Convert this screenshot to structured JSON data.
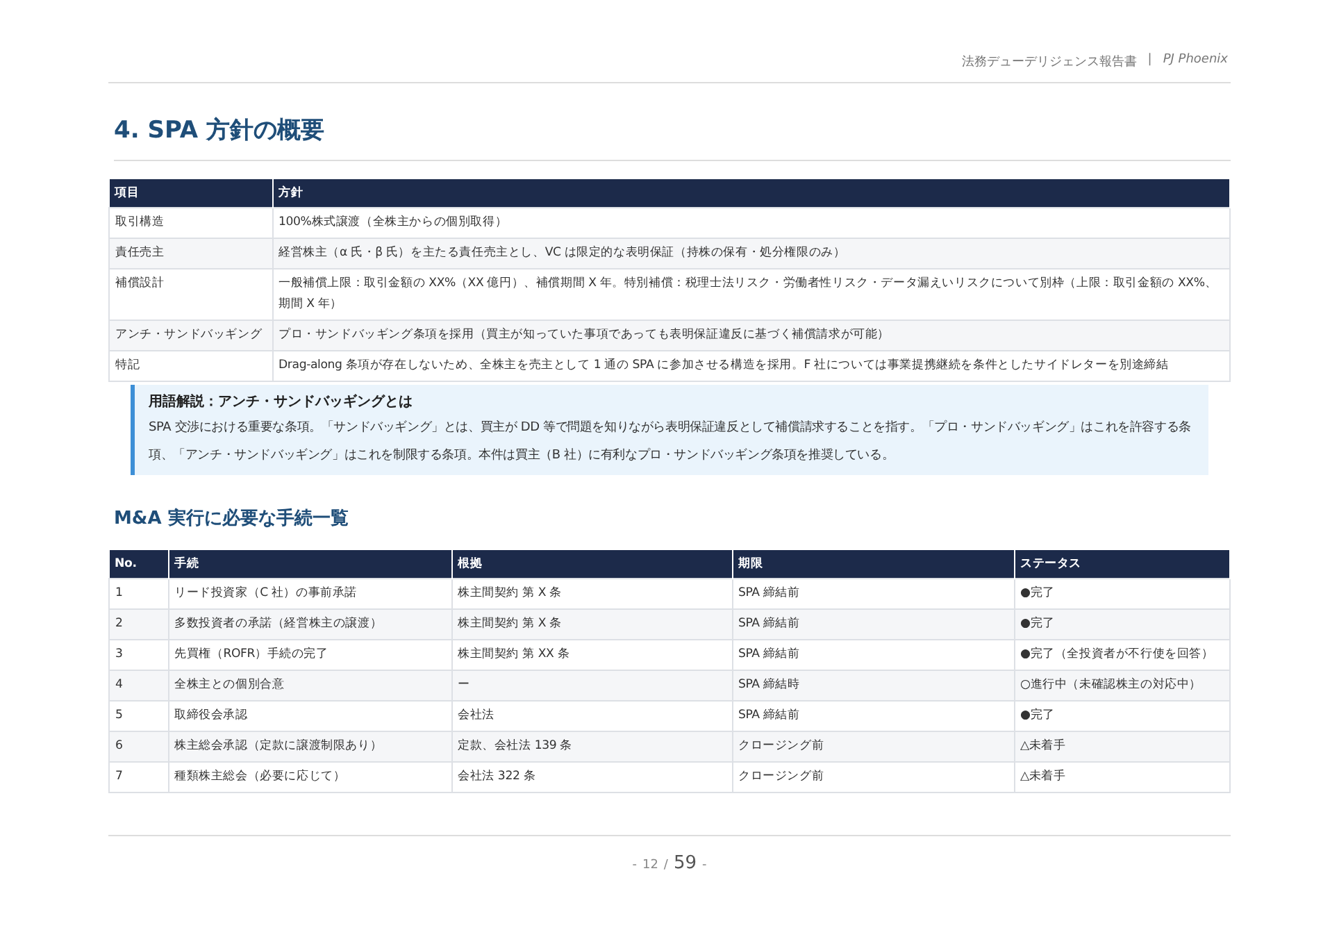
{
  "header": {
    "document": "法務デューデリジェンス報告書",
    "separator": "|",
    "project": "PJ Phoenix"
  },
  "section_title": "4. SPA 方針の概要",
  "policy_table": {
    "columns": [
      "項目",
      "方針"
    ],
    "rows": [
      {
        "item": "取引構造",
        "policy": "100%株式譲渡（全株主からの個別取得）"
      },
      {
        "item": "責任売主",
        "policy": "経営株主（α 氏・β 氏）を主たる責任売主とし、VC は限定的な表明保証（持株の保有・処分権限のみ）"
      },
      {
        "item": "補償設計",
        "policy": "一般補償上限：取引金額の XX%（XX 億円）、補償期間 X 年。特別補償：税理士法リスク・労働者性リスク・データ漏えいリスクについて別枠（上限：取引金額の XX%、期間 X 年）"
      },
      {
        "item": "アンチ・サンドバッギング",
        "policy": "プロ・サンドバッギング条項を採用（買主が知っていた事項であっても表明保証違反に基づく補償請求が可能）"
      },
      {
        "item": "特記",
        "policy": "Drag-along 条項が存在しないため、全株主を売主として 1 通の SPA に参加させる構造を採用。F 社については事業提携継続を条件としたサイドレターを別途締結"
      }
    ]
  },
  "glossary": {
    "title": "用語解説：アンチ・サンドバッギングとは",
    "body": "SPA 交渉における重要な条項。「サンドバッギング」とは、買主が DD 等で問題を知りながら表明保証違反として補償請求することを指す。「プロ・サンドバッギング」はこれを許容する条項、「アンチ・サンドバッギング」はこれを制限する条項。本件は買主（B 社）に有利なプロ・サンドバッギング条項を推奨している。"
  },
  "subsection_title": "M&A 実行に必要な手続一覧",
  "procedure_table": {
    "columns": [
      "No.",
      "手続",
      "根拠",
      "期限",
      "ステータス"
    ],
    "rows": [
      [
        "1",
        "リード投資家（C 社）の事前承諾",
        "株主間契約 第 X 条",
        "SPA 締結前",
        "●完了"
      ],
      [
        "2",
        "多数投資者の承諾（経営株主の譲渡）",
        "株主間契約 第 X 条",
        "SPA 締結前",
        "●完了"
      ],
      [
        "3",
        "先買権（ROFR）手続の完了",
        "株主間契約 第 XX 条",
        "SPA 締結前",
        "●完了（全投資者が不行使を回答）"
      ],
      [
        "4",
        "全株主との個別合意",
        "ー",
        "SPA 締結時",
        "○進行中（未確認株主の対応中）"
      ],
      [
        "5",
        "取締役会承認",
        "会社法",
        "SPA 締結前",
        "●完了"
      ],
      [
        "6",
        "株主総会承認（定款に譲渡制限あり）",
        "定款、会社法 139 条",
        "クロージング前",
        "△未着手"
      ],
      [
        "7",
        "種類株主総会（必要に応じて）",
        "会社法 322 条",
        "クロージング前",
        "△未着手"
      ]
    ]
  },
  "footer": {
    "prefix": "-",
    "current_page": "12",
    "slash": "/",
    "total_pages": "59",
    "suffix": "-"
  }
}
